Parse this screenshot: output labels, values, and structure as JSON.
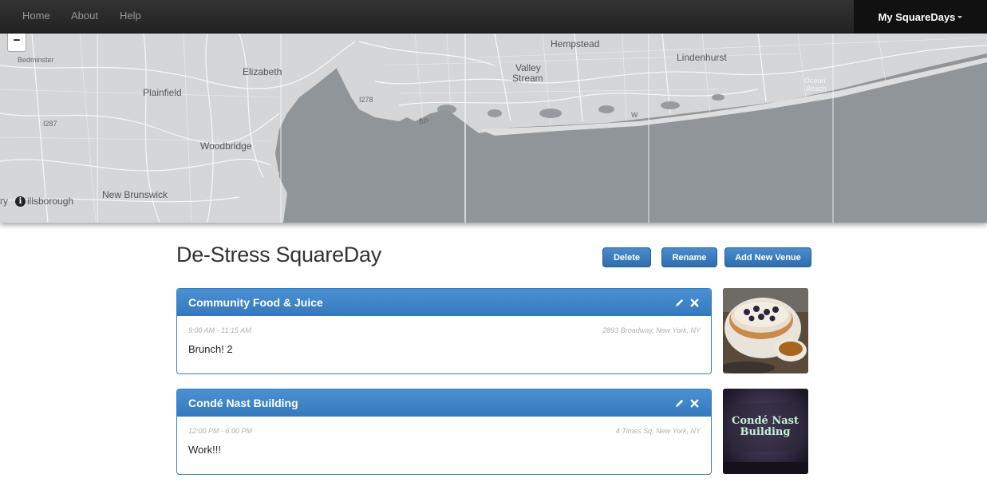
{
  "nav": {
    "links": [
      "Home",
      "About",
      "Help"
    ],
    "user_menu": "My SquareDays"
  },
  "map": {
    "zoom_out": "−",
    "info": "i",
    "labels": [
      "Bedminster",
      "Elizabeth",
      "Plainfield",
      "Woodbridge",
      "New Brunswick",
      "ry",
      "illsborough",
      "Hempstead",
      "Valley",
      "Stream",
      "Lindenhurst",
      "Ocean",
      "Beach",
      "I287",
      "I278",
      "BP",
      "W"
    ]
  },
  "page": {
    "title": "De-Stress SquareDay",
    "buttons": {
      "delete": "Delete",
      "rename": "Rename",
      "add_venue": "Add New Venue"
    }
  },
  "venues": [
    {
      "name": "Community Food & Juice",
      "time": "9:00 AM - 11:15 AM",
      "address": "2893 Broadway, New York, NY",
      "note": "Brunch! 2"
    },
    {
      "name": "Condé Nast Building",
      "time": "12:00 PM - 6:00 PM",
      "address": "4 Times Sq, New York, NY",
      "note": "Work!!!",
      "sign_text": [
        "Condé Nast",
        "Building"
      ]
    }
  ],
  "colors": {
    "navbar": "#222222",
    "map_water": "#8f9598",
    "map_land": "#d4d6d7",
    "accent": "#3579bc"
  }
}
